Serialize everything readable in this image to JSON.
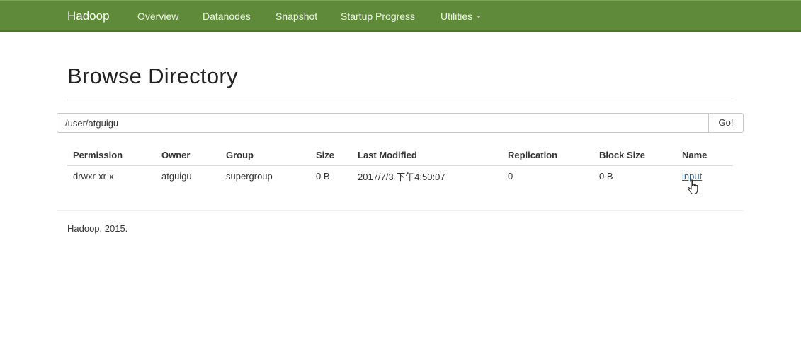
{
  "navbar": {
    "brand": "Hadoop",
    "items": [
      {
        "label": "Overview"
      },
      {
        "label": "Datanodes"
      },
      {
        "label": "Snapshot"
      },
      {
        "label": "Startup Progress"
      },
      {
        "label": "Utilities",
        "icon": "caret-down-icon"
      }
    ],
    "background_color": "#5f8a3a"
  },
  "main": {
    "title": "Browse Directory",
    "path_input": {
      "value": "/user/atguigu"
    },
    "go_label": "Go!"
  },
  "table": {
    "columns": [
      "Permission",
      "Owner",
      "Group",
      "Size",
      "Last Modified",
      "Replication",
      "Block Size",
      "Name"
    ],
    "rows": [
      {
        "permission": "drwxr-xr-x",
        "owner": "atguigu",
        "group": "supergroup",
        "size": "0 B",
        "last_modified": "2017/7/3 下午4:50:07",
        "replication": "0",
        "block_size": "0 B",
        "name": "input"
      }
    ]
  },
  "footer": {
    "text": "Hadoop, 2015."
  },
  "cursor": {
    "icon": "hand-pointer-icon"
  }
}
